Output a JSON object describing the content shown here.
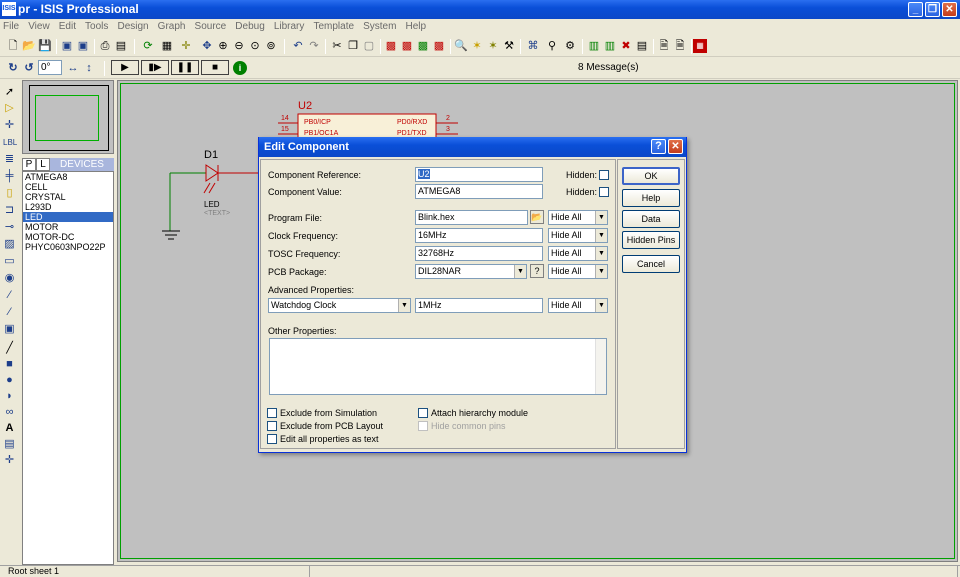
{
  "window": {
    "title": "pr - ISIS Professional",
    "app_icon_text": "ISIS"
  },
  "menu": [
    "File",
    "View",
    "Edit",
    "Tools",
    "Design",
    "Graph",
    "Source",
    "Debug",
    "Library",
    "Template",
    "System",
    "Help"
  ],
  "toolbar2": {
    "rotation_value": "0°",
    "messages": "8 Message(s)"
  },
  "sidebar": {
    "tab_p": "P",
    "tab_l": "L",
    "devices_header": "DEVICES",
    "devices": [
      "ATMEGA8",
      "CELL",
      "CRYSTAL",
      "L293D",
      "LED",
      "MOTOR",
      "MOTOR-DC",
      "PHYC0603NPO22P"
    ],
    "selected_index": 4
  },
  "schematic": {
    "chip_ref": "U2",
    "pins": [
      {
        "num": "14",
        "name_left": "PB0/ICP",
        "num_right": "2",
        "name_right": "PD0/RXD"
      },
      {
        "num": "15",
        "name_left": "PB1/OC1A",
        "num_right": "3",
        "name_right": "PD1/TXD"
      }
    ],
    "led_ref": "D1",
    "led_value": "LED",
    "led_text": "<TEXT>"
  },
  "dialog": {
    "title": "Edit Component",
    "component_reference": {
      "label": "Component Reference:",
      "value": "U2",
      "hidden_label": "Hidden:"
    },
    "component_value": {
      "label": "Component Value:",
      "value": "ATMEGA8",
      "hidden_label": "Hidden:"
    },
    "program_file": {
      "label": "Program File:",
      "value": "Blink.hex",
      "visibility": "Hide All"
    },
    "clock_frequency": {
      "label": "Clock Frequency:",
      "value": "16MHz",
      "visibility": "Hide All"
    },
    "tosc_frequency": {
      "label": "TOSC Frequency:",
      "value": "32768Hz",
      "visibility": "Hide All"
    },
    "pcb_package": {
      "label": "PCB Package:",
      "value": "DIL28NAR",
      "help": "?",
      "visibility": "Hide All"
    },
    "advanced_properties": {
      "label": "Advanced Properties:",
      "property": "Watchdog Clock",
      "value": "1MHz",
      "visibility": "Hide All"
    },
    "other_properties": {
      "label": "Other Properties:",
      "value": ""
    },
    "checkboxes": {
      "exclude_simulation": "Exclude from Simulation",
      "exclude_pcb": "Exclude from PCB Layout",
      "edit_all": "Edit all properties as text",
      "attach_hierarchy": "Attach hierarchy module",
      "hide_common_pins": "Hide common pins"
    },
    "buttons": {
      "ok": "OK",
      "help": "Help",
      "data": "Data",
      "hidden_pins": "Hidden Pins",
      "cancel": "Cancel"
    }
  },
  "status": {
    "sheet": "Root sheet 1"
  },
  "colors": {
    "title_blue": "#0a4fd8",
    "canvas_gray": "#c0c0c0",
    "schematic_red": "#c00000",
    "selection": "#316ac5"
  }
}
